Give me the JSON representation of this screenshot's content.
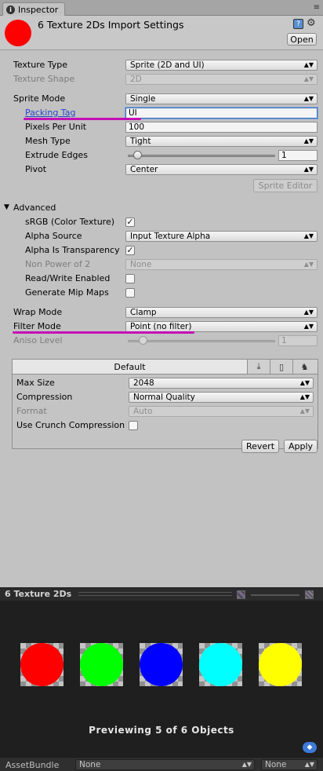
{
  "tab": {
    "label": "Inspector"
  },
  "header": {
    "title": "6 Texture 2Ds Import Settings",
    "open_label": "Open"
  },
  "fields": {
    "texture_type": {
      "label": "Texture Type",
      "value": "Sprite (2D and UI)"
    },
    "texture_shape": {
      "label": "Texture Shape",
      "value": "2D"
    },
    "sprite_mode": {
      "label": "Sprite Mode",
      "value": "Single"
    },
    "packing_tag": {
      "label": "Packing Tag",
      "value": "UI"
    },
    "pixels_per_unit": {
      "label": "Pixels Per Unit",
      "value": "100"
    },
    "mesh_type": {
      "label": "Mesh Type",
      "value": "Tight"
    },
    "extrude_edges": {
      "label": "Extrude Edges",
      "value": "1",
      "fraction": 0.04
    },
    "pivot": {
      "label": "Pivot",
      "value": "Center"
    },
    "sprite_editor_label": "Sprite Editor",
    "advanced_label": "Advanced",
    "srgb": {
      "label": "sRGB (Color Texture)",
      "checked": true
    },
    "alpha_source": {
      "label": "Alpha Source",
      "value": "Input Texture Alpha"
    },
    "alpha_transparency": {
      "label": "Alpha Is Transparency",
      "checked": true
    },
    "non_power_of_2": {
      "label": "Non Power of 2",
      "value": "None"
    },
    "read_write": {
      "label": "Read/Write Enabled",
      "checked": false
    },
    "mip_maps": {
      "label": "Generate Mip Maps",
      "checked": false
    },
    "wrap_mode": {
      "label": "Wrap Mode",
      "value": "Clamp"
    },
    "filter_mode": {
      "label": "Filter Mode",
      "value": "Point (no filter)"
    },
    "aniso_level": {
      "label": "Aniso Level",
      "value": "1",
      "fraction": 0.08
    }
  },
  "platform": {
    "default_tab": "Default",
    "tab_icons": [
      "download-icon",
      "phone-icon",
      "android-icon"
    ],
    "max_size": {
      "label": "Max Size",
      "value": "2048"
    },
    "compression": {
      "label": "Compression",
      "value": "Normal Quality"
    },
    "format": {
      "label": "Format",
      "value": "Auto"
    },
    "crunch": {
      "label": "Use Crunch Compression",
      "checked": false
    }
  },
  "buttons": {
    "revert": "Revert",
    "apply": "Apply"
  },
  "preview": {
    "title": "6 Texture 2Ds",
    "caption": "Previewing 5 of 6 Objects",
    "thumbnails": [
      "#ff0000",
      "#00ff00",
      "#0000ff",
      "#00ffff",
      "#ffff00"
    ]
  },
  "assetbundle": {
    "label": "AssetBundle",
    "name": "None",
    "variant": "None"
  },
  "colors": {
    "annotation": "#c40fb4",
    "header_thumb": "#ff0000"
  }
}
